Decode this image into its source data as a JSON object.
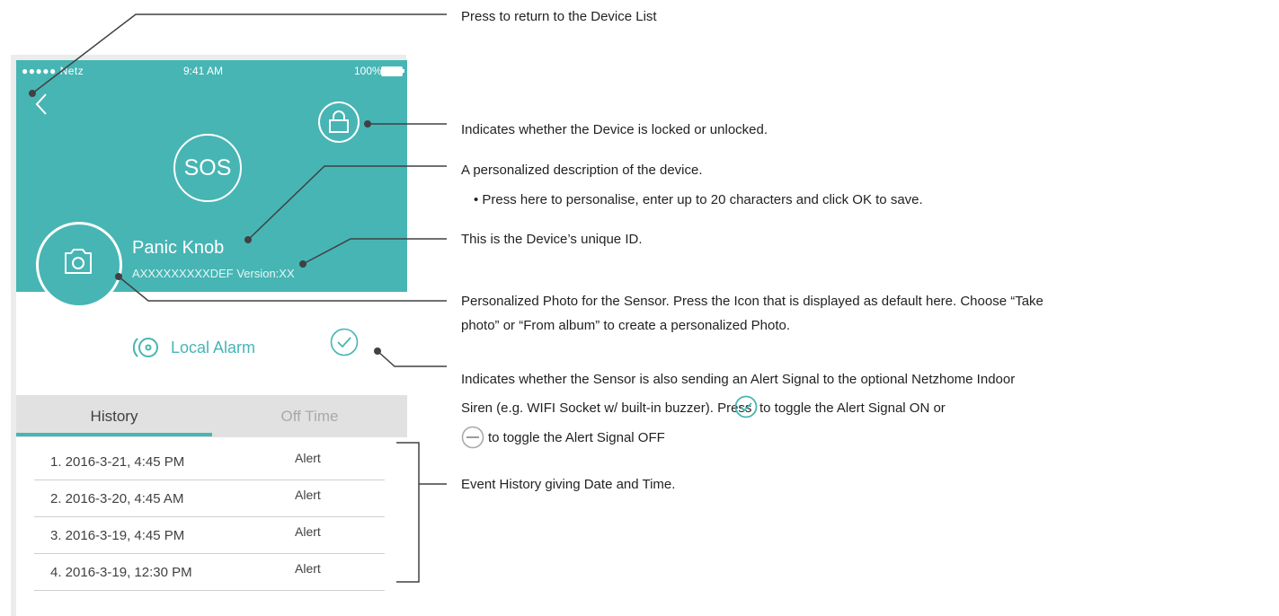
{
  "status_bar": {
    "carrier": "●●●●● Netz",
    "time": "9:41 AM",
    "battery": "100%"
  },
  "device": {
    "sos_label": "SOS",
    "name": "Panic Knob",
    "id_version": "AXXXXXXXXXDEF Version:XX"
  },
  "local_alarm": {
    "label": "Local Alarm"
  },
  "tabs": [
    {
      "label": "History"
    },
    {
      "label": "Off Time"
    }
  ],
  "history": [
    {
      "date": "1. 2016-3-21,  4:45 PM",
      "status": "Alert"
    },
    {
      "date": "2. 2016-3-20,  4:45 AM",
      "status": "Alert"
    },
    {
      "date": "3. 2016-3-19,  4:45 PM",
      "status": "Alert"
    },
    {
      "date": "4. 2016-3-19,  12:30 PM",
      "status": "Alert"
    }
  ],
  "callouts": {
    "back": "Press to return to the Device List",
    "lock": "Indicates whether the Device is locked or unlocked.",
    "description": "A personalized description of the device.",
    "description_bullet": "•  Press here to personalise, enter up to 20 characters and click OK to save.",
    "unique_id": "This is the Device’s unique ID.",
    "photo_line1": "Personalized Photo for the Sensor. Press the Icon that is displayed as default here. Choose “Take",
    "photo_line2": "photo” or “From album” to create a personalized Photo.",
    "siren_line1": "Indicates whether the Sensor is also sending an Alert Signal to the optional Netzhome Indoor",
    "siren_line2a": "Siren (e.g. WIFI Socket w/ built-in buzzer). Press",
    "siren_line2b": "to toggle the Alert Signal ON or",
    "siren_line3": "to toggle the Alert Signal OFF",
    "history": "Event History giving Date and Time."
  },
  "colors": {
    "accent": "#47b5b4",
    "tab_bg": "#e1e1e1",
    "divider": "#cfcfcf",
    "text": "#231f20"
  },
  "icons": [
    "back-chevron-icon",
    "lock-icon",
    "camera-icon",
    "alarm-speaker-icon",
    "check-circle-icon",
    "minus-circle-icon"
  ]
}
